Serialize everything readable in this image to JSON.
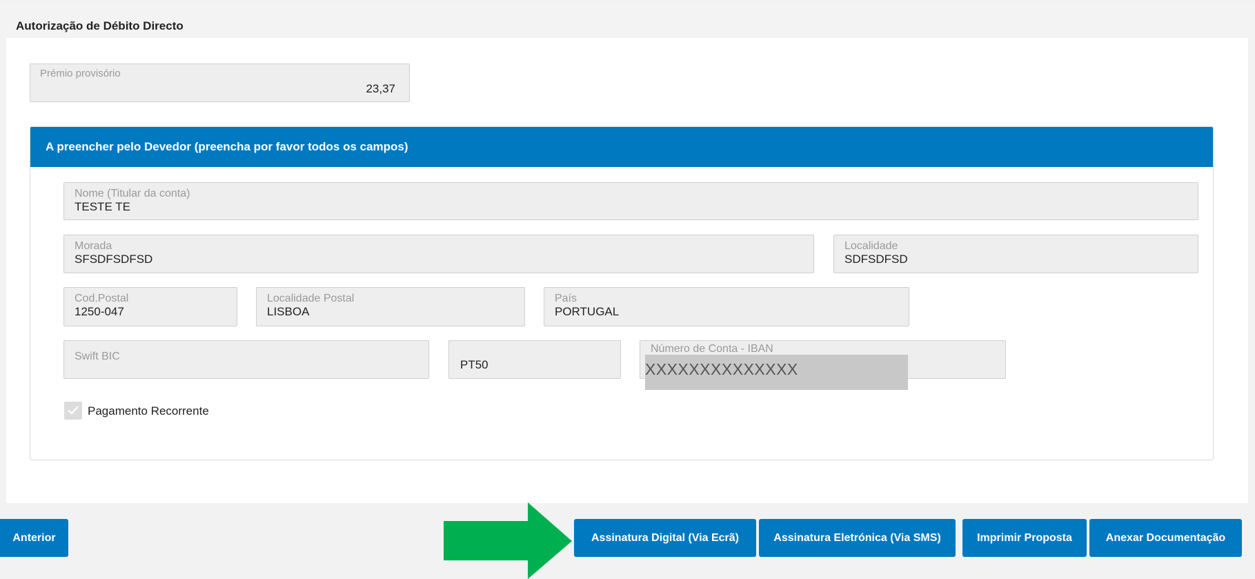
{
  "header": {
    "title": "Autorização de Débito Directo"
  },
  "premio": {
    "label": "Prémio provisório",
    "value": "23,37"
  },
  "devedor": {
    "title": "A preencher pelo Devedor (preencha por favor todos os campos)",
    "nome": {
      "label": "Nome (Titular da conta)",
      "value": "TESTE TE"
    },
    "morada": {
      "label": "Morada",
      "value": "SFSDFSDFSD"
    },
    "localidade": {
      "label": "Localidade",
      "value": "SDFSDFSD"
    },
    "cod_postal": {
      "label": "Cod.Postal",
      "value": "1250-047"
    },
    "localidade_postal": {
      "label": "Localidade Postal",
      "value": "LISBOA"
    },
    "pais": {
      "label": "País",
      "value": "PORTUGAL"
    },
    "swift": {
      "label": "Swift BIC",
      "value": ""
    },
    "iban_prefix": {
      "value": "PT50"
    },
    "iban": {
      "label": "Número de Conta - IBAN",
      "value": "XXXXXXXXXXXXXX"
    },
    "recorrente": {
      "label": "Pagamento Recorrente",
      "checked": true
    }
  },
  "buttons": {
    "anterior": "Anterior",
    "assinatura_digital": "Assinatura Digital (Via Ecrã)",
    "assinatura_eletronica": "Assinatura Eletrónica (Via SMS)",
    "imprimir": "Imprimir Proposta",
    "anexar": "Anexar Documentação"
  },
  "colors": {
    "accent": "#0079c1",
    "arrow": "#00b050",
    "field_bg": "#eeeeee",
    "page_bg": "#f2f2f2"
  },
  "icons": {
    "check": "check-icon",
    "arrow": "arrow-right-icon"
  }
}
